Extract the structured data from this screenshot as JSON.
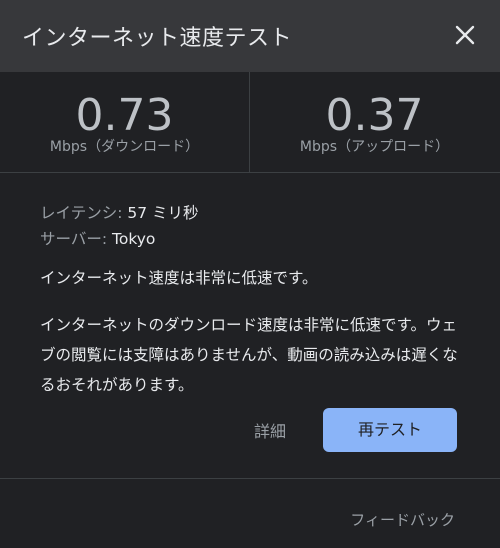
{
  "dialog": {
    "title": "インターネット速度テスト",
    "close_icon": "close-icon"
  },
  "speeds": {
    "download": {
      "value": "0.73",
      "unit": "Mbps（ダウンロード）"
    },
    "upload": {
      "value": "0.37",
      "unit": "Mbps（アップロード）"
    }
  },
  "info": {
    "latency_label": "レイテンシ:",
    "latency_value": " 57 ミリ秒",
    "server_label": "サーバー:",
    "server_value": " Tokyo"
  },
  "messages": {
    "summary": "インターネット速度は非常に低速です。",
    "detail": "インターネットのダウンロード速度は非常に低速です。ウェブの閲覧には支障はありませんが、動画の読み込みは遅くなるおそれがあります。"
  },
  "actions": {
    "details_label": "詳細",
    "retest_label": "再テスト",
    "feedback_label": "フィードバック"
  },
  "colors": {
    "header_bg": "#37383b",
    "body_bg": "#202124",
    "accent": "#8ab4f8"
  }
}
